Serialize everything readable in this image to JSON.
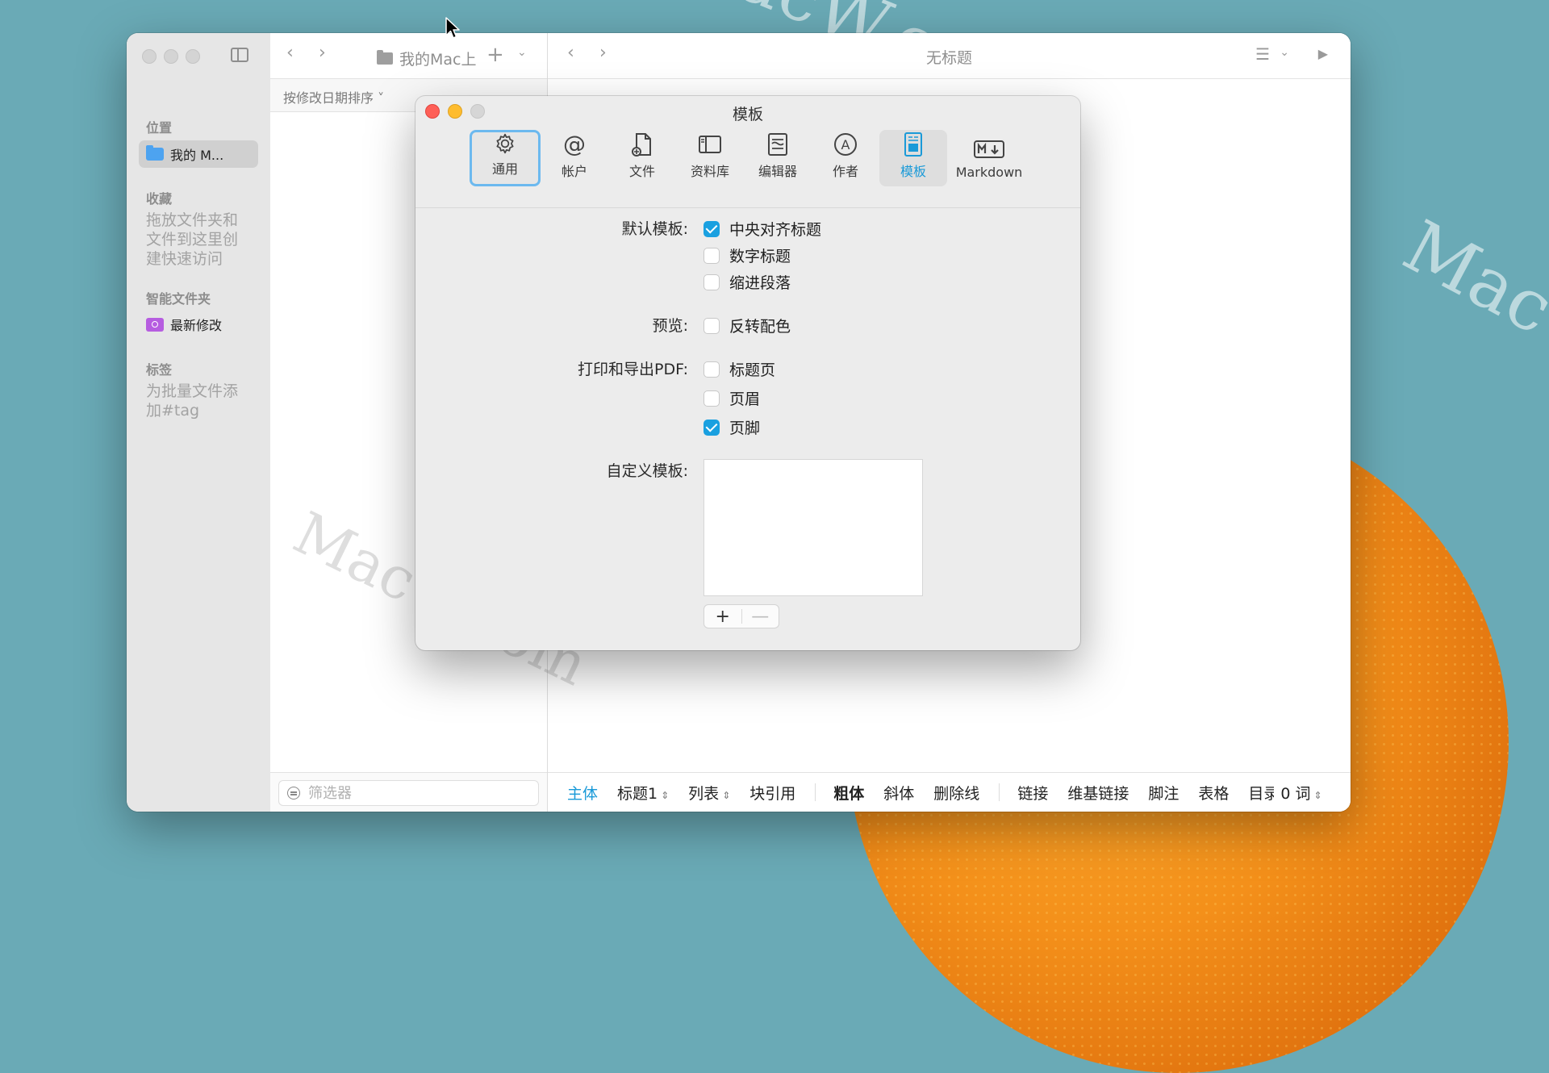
{
  "background": {
    "watermarks": [
      "MacW.com",
      "MacW.com",
      "MacW.com"
    ]
  },
  "window": {
    "location_label": "我的Mac上",
    "doc_title": "无标题",
    "sort_label": "按修改日期排序",
    "filter_placeholder": "筛选器"
  },
  "sidebar": {
    "location_header": "位置",
    "location_item": "我的 M...",
    "favorites_header": "收藏",
    "favorites_hint": "拖放文件夹和文件到这里创建快速访问",
    "smart_header": "智能文件夹",
    "smart_item": "最新修改",
    "tags_header": "标签",
    "tags_hint": "为批量文件添加#tag"
  },
  "statusbar": {
    "items": [
      "主体",
      "标题1",
      "列表",
      "块引用",
      "粗体",
      "斜体",
      "删除线",
      "链接",
      "维基链接",
      "脚注",
      "表格",
      "目录",
      "0 词"
    ]
  },
  "dialog": {
    "title": "模板",
    "tabs": [
      {
        "label": "通用",
        "icon": "gear-icon"
      },
      {
        "label": "帐户",
        "icon": "at-icon"
      },
      {
        "label": "文件",
        "icon": "file-add-icon"
      },
      {
        "label": "资料库",
        "icon": "library-icon"
      },
      {
        "label": "编辑器",
        "icon": "editor-icon"
      },
      {
        "label": "作者",
        "icon": "author-icon"
      },
      {
        "label": "模板",
        "icon": "template-icon"
      },
      {
        "label": "Markdown",
        "icon": "markdown-icon"
      }
    ],
    "default_template_label": "默认模板:",
    "default_options": [
      {
        "label": "中央对齐标题",
        "checked": true
      },
      {
        "label": "数字标题",
        "checked": false
      },
      {
        "label": "缩进段落",
        "checked": false
      }
    ],
    "preview_label": "预览:",
    "preview_option": {
      "label": "反转配色",
      "checked": false
    },
    "print_label": "打印和导出PDF:",
    "print_options": [
      {
        "label": "标题页",
        "checked": false
      },
      {
        "label": "页眉",
        "checked": false
      },
      {
        "label": "页脚",
        "checked": true
      }
    ],
    "custom_label": "自定义模板:",
    "add_symbol": "+",
    "remove_symbol": "—"
  },
  "colors": {
    "accent": "#1a9ad8",
    "close": "#fe5f57",
    "minimize": "#febc2e",
    "background": "#6aaab6"
  }
}
